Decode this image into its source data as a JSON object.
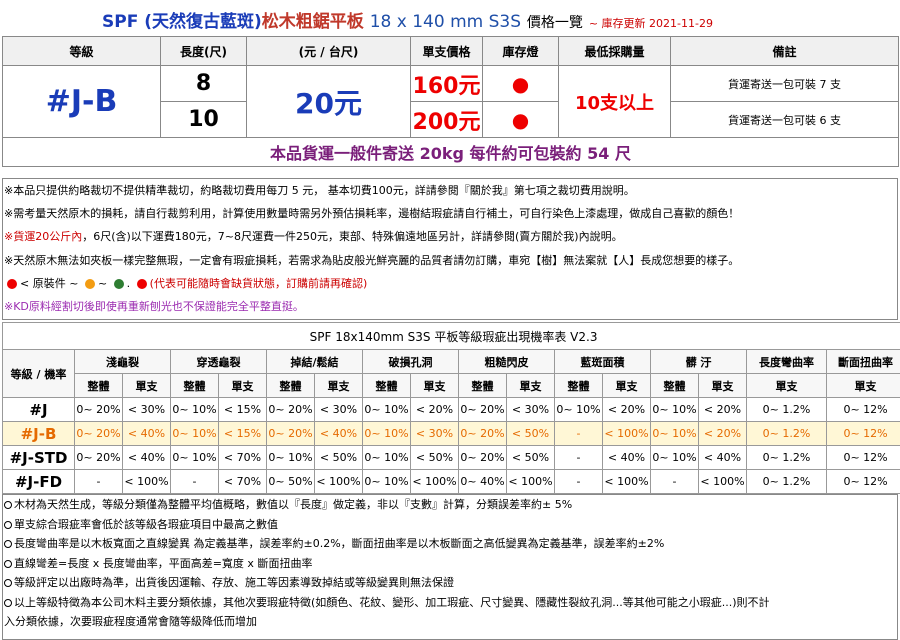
{
  "title": {
    "brand": "SPF",
    "subtitle": "(天然復古藍斑)",
    "product": "松木粗鋸平板",
    "dims": "18 x 140 mm S3S",
    "pricelist": "價格一覽",
    "update": "~ 庫存更新 2021-11-29"
  },
  "price_table": {
    "headers": [
      "等級",
      "長度(尺)",
      "(元 / 台尺)",
      "單支價格",
      "庫存燈",
      "最低採購量",
      "備註"
    ],
    "grade": "#J-B",
    "unit_price": "20元",
    "min_order": "10支以上",
    "rows": [
      {
        "length": "8",
        "price": "160元",
        "stock": "●",
        "note": "貨運寄送一包可裝 7 支"
      },
      {
        "length": "10",
        "price": "200元",
        "stock": "●",
        "note": "貨運寄送一包可裝 6 支"
      }
    ],
    "shipping": "本品貨運一般件寄送 20kg 每件約可包裝約 54 尺"
  },
  "notes": [
    "※本品只提供約略裁切不提供精準裁切，約略裁切費用每刀 5 元， 基本切費100元，詳請參閱『關於我』第七項之裁切費用說明。",
    "※需考量天然原木的損耗，請自行裁剪利用，計算使用數量時需另外預估損耗率，邊樹結瑕疵請自行補土，可自行染色上漆處理，做成自己喜歡的顏色！",
    "※貨運20公斤內，6尺(含)以下運費180元，7~8尺運費一件250元，東部、特殊偏遠地區另計，詳請參閱(賣方關於我)內說明。",
    "※天然原木無法如夾板一樣完整無瑕，一定會有瑕疵損耗，若需求為貼皮般光鮮亮麗的品質者請勿訂購，車宛【樹】無法案就【人】長成您想要的樣子。",
    "< 原裝件 ~",
    "(代表可能隨時會缺貨狀態，訂購前請再確認)",
    "※KD原料經割切後即使再重新刨光也不保證能完全平整直挺。"
  ],
  "notes_red_prefix": "※貨運20公斤內",
  "defect_table": {
    "caption": "SPF 18x140mm S3S 平板等級瑕疵出現機率表 V2.3",
    "corner": "等級 / 機率",
    "groups": [
      "淺龜裂",
      "穿透龜裂",
      "掉結/鬆結",
      "破損孔洞",
      "粗糙閃皮",
      "藍斑面積",
      "髒 汙",
      "長度彎曲率",
      "斷面扭曲率"
    ],
    "sub_whole": "整體",
    "sub_single": "單支",
    "rows": [
      {
        "grade": "#J",
        "cells": [
          "0~ 20%",
          "< 30%",
          "0~ 10%",
          "< 15%",
          "0~ 20%",
          "< 30%",
          "0~ 10%",
          "< 20%",
          "0~ 20%",
          "< 30%",
          "0~ 10%",
          "< 20%",
          "0~ 10%",
          "< 20%",
          "0~ 1.2%",
          "0~ 12%"
        ]
      },
      {
        "grade": "#J-B",
        "cells": [
          "0~ 20%",
          "< 40%",
          "0~ 10%",
          "< 15%",
          "0~ 20%",
          "< 40%",
          "0~ 10%",
          "< 30%",
          "0~ 20%",
          "< 50%",
          "-",
          "< 100%",
          "0~ 10%",
          "< 20%",
          "0~ 1.2%",
          "0~ 12%"
        ]
      },
      {
        "grade": "#J-STD",
        "cells": [
          "0~ 20%",
          "< 40%",
          "0~ 10%",
          "< 70%",
          "0~ 10%",
          "< 50%",
          "0~ 10%",
          "< 50%",
          "0~ 20%",
          "< 50%",
          "-",
          "< 40%",
          "0~ 10%",
          "< 40%",
          "0~ 1.2%",
          "0~ 12%"
        ]
      },
      {
        "grade": "#J-FD",
        "cells": [
          "-",
          "< 100%",
          "-",
          "< 70%",
          "0~ 50%",
          "< 100%",
          "0~ 10%",
          "< 100%",
          "0~ 40%",
          "< 100%",
          "-",
          "< 100%",
          "-",
          "< 100%",
          "0~ 1.2%",
          "0~ 12%"
        ]
      }
    ]
  },
  "bottom_notes": [
    "木材為天然生成，等級分類僅為整體平均值概略，數值以『長度』做定義，非以『支數』計算，分類誤差率約± 5%",
    "單支綜合瑕疵率會低於該等級各瑕疵項目中最高之數值",
    "長度彎曲率是以木板寬面之直線變異 為定義基準，誤差率約±0.2%，斷面扭曲率是以木板斷面之高低變異為定義基準，誤差率約±2%",
    "直線彎差=長度 x 長度彎曲率，平面高差=寬度 x 斷面扭曲率",
    "等級評定以出廠時為準，出貨後因運輸、存放、施工等因素導致掉結或等級變異則無法保證",
    "以上等級特徵為本公司木料主要分類依據，其他次要瑕疵特徵(如顏色、花紋、變形、加工瑕疵、尺寸變異、隱藏性裂紋孔洞...等其他可能之小瑕疵...)則不計",
    "入分類依據，次要瑕疵程度通常會隨等級降低而增加"
  ],
  "colors": {
    "accent_blue": "#1a3cb8",
    "red": "#e00000",
    "purple": "#7a1f7a",
    "orange": "#e56a00"
  }
}
